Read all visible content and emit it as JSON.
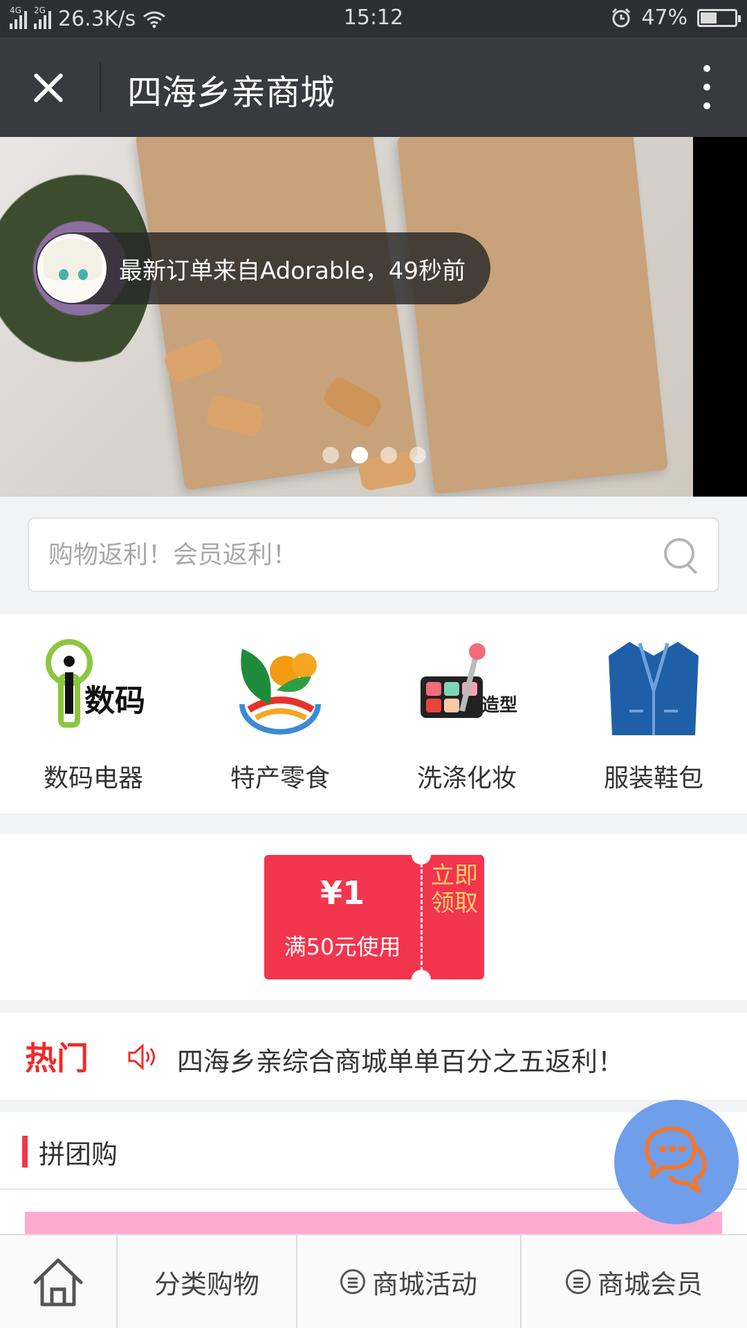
{
  "status_bar": {
    "network_a": "4G",
    "network_b": "2G",
    "speed": "26.3K/s",
    "time": "15:12",
    "battery": "47%",
    "battery_level": 0.47
  },
  "title_bar": {
    "title": "四海乡亲商城"
  },
  "banner": {
    "order_notice": "最新订单来自Adorable，49秒前",
    "slide_count": 4,
    "active_slide": 1
  },
  "search": {
    "placeholder": "购物返利！会员返利！"
  },
  "categories": [
    {
      "label": "数码电器",
      "icon": "digital-icon"
    },
    {
      "label": "特产零食",
      "icon": "fruit-icon"
    },
    {
      "label": "洗涤化妆",
      "icon": "makeup-icon"
    },
    {
      "label": "服装鞋包",
      "icon": "suit-icon"
    }
  ],
  "coupon": {
    "amount": "¥1",
    "condition": "满50元使用",
    "claim": "立即领取"
  },
  "hot": {
    "label": "热门",
    "text": "四海乡亲综合商城单单百分之五返利！"
  },
  "group_buy": {
    "title": "拼团购"
  },
  "bottom_nav": {
    "home_icon": "home-icon",
    "category": "分类购物",
    "activity": "商城活动",
    "member": "商城会员"
  },
  "colors": {
    "accent": "#f3354e",
    "title_bar": "#393a3f",
    "hot_red": "#f22a2a",
    "chat_fab": "#6f9eea"
  }
}
